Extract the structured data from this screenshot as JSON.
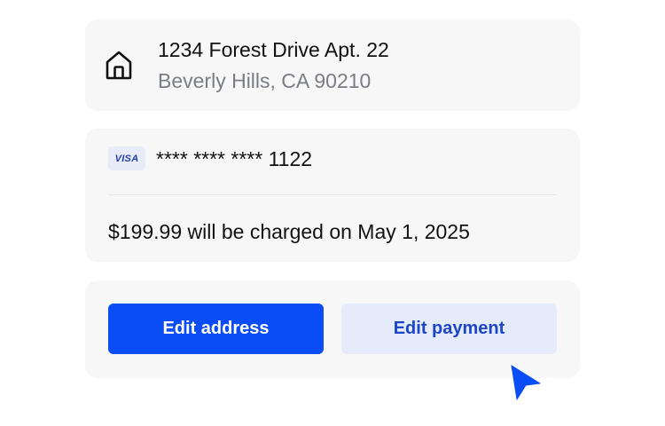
{
  "address": {
    "icon": "home-icon",
    "line1": "1234 Forest Drive Apt. 22",
    "line2": "Beverly Hills, CA 90210"
  },
  "payment": {
    "card_brand": "VISA",
    "card_number": "**** **** **** 1122",
    "charge_text": "$199.99 will be charged on May 1, 2025"
  },
  "actions": {
    "edit_address_label": "Edit address",
    "edit_payment_label": "Edit payment"
  },
  "colors": {
    "primary": "#0a4cf5",
    "secondary_bg": "#e6ebfb",
    "secondary_text": "#1a45c9",
    "card_bg": "#f7f7f7",
    "muted_text": "#7a7d82",
    "cursor": "#0a4cf5"
  },
  "cursor": {
    "icon": "pointer-cursor-icon"
  }
}
